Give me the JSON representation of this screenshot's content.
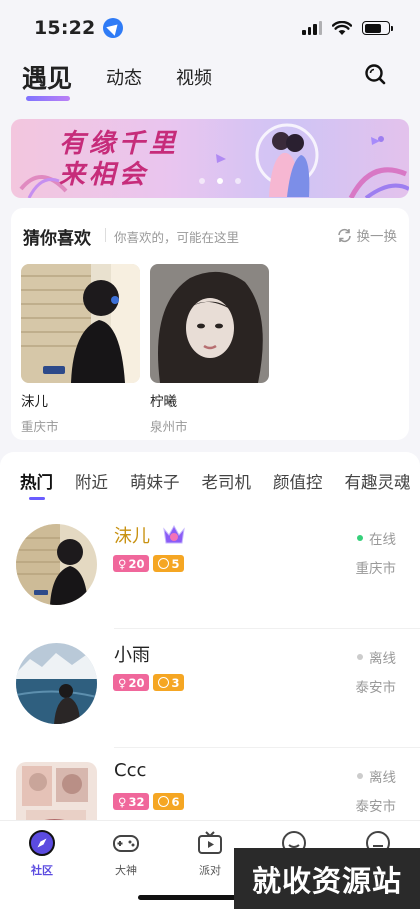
{
  "status_bar": {
    "time": "15:22"
  },
  "top_tabs": [
    {
      "label": "遇见",
      "active": true
    },
    {
      "label": "动态",
      "active": false
    },
    {
      "label": "视频",
      "active": false
    }
  ],
  "banner": {
    "slogan_line1": "有缘千里",
    "slogan_line2": "来相会"
  },
  "guess": {
    "title": "猜你喜欢",
    "subtitle": "你喜欢的，可能在这里",
    "refresh_label": "换一换",
    "cards": [
      {
        "name": "沫儿",
        "city": "重庆市"
      },
      {
        "name": "柠曦",
        "city": "泉州市"
      }
    ]
  },
  "categories": [
    {
      "label": "热门",
      "active": true
    },
    {
      "label": "附近",
      "active": false
    },
    {
      "label": "萌妹子",
      "active": false
    },
    {
      "label": "老司机",
      "active": false
    },
    {
      "label": "颜值控",
      "active": false
    },
    {
      "label": "有趣灵魂",
      "active": false
    }
  ],
  "users": [
    {
      "name": "沫儿",
      "age": "20",
      "level": "5",
      "status": "在线",
      "city": "重庆市",
      "vip": true
    },
    {
      "name": "小雨",
      "age": "20",
      "level": "3",
      "status": "离线",
      "city": "泰安市",
      "vip": false
    },
    {
      "name": "Ccc",
      "age": "32",
      "level": "6",
      "status": "离线",
      "city": "泰安市",
      "vip": false
    }
  ],
  "bottom_nav": [
    {
      "label": "社区",
      "icon": "compass-icon",
      "active": true
    },
    {
      "label": "大神",
      "icon": "gamepad-icon",
      "active": false
    },
    {
      "label": "派对",
      "icon": "tv-play-icon",
      "active": false
    },
    {
      "label": "",
      "icon": "chat-icon",
      "active": false
    },
    {
      "label": "",
      "icon": "profile-icon",
      "active": false
    }
  ],
  "watermark": "就收资源站",
  "colors": {
    "accent": "#6a5cff",
    "online": "#35d07a",
    "vip_name": "#c89212",
    "sex_tag": "#f0679b",
    "level_tag": "#f5a623"
  }
}
